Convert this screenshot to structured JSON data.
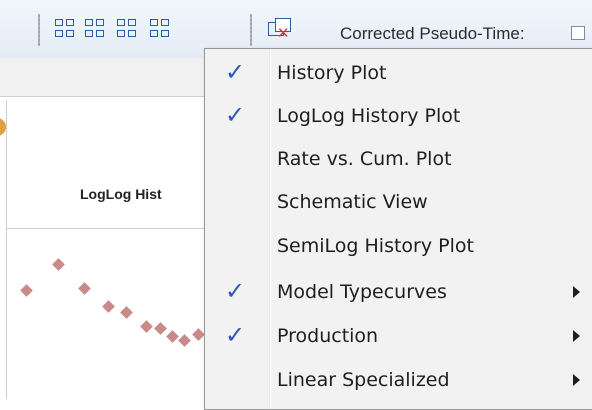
{
  "toolbar": {
    "corrected_label": "Corrected Pseudo-Time:",
    "corrected_checked": false
  },
  "plot": {
    "title": "LogLog Hist"
  },
  "menu": {
    "items": [
      {
        "label": "History Plot",
        "checked": true,
        "submenu": false
      },
      {
        "label": "LogLog History Plot",
        "checked": true,
        "submenu": false
      },
      {
        "label": "Rate vs. Cum. Plot",
        "checked": false,
        "submenu": false
      },
      {
        "label": "Schematic View",
        "checked": false,
        "submenu": false
      },
      {
        "label": "SemiLog History Plot",
        "checked": false,
        "submenu": false
      },
      {
        "label": "Model Typecurves",
        "checked": true,
        "submenu": true
      },
      {
        "label": "Production",
        "checked": true,
        "submenu": true
      },
      {
        "label": "Linear Specialized",
        "checked": false,
        "submenu": true
      }
    ],
    "check_glyph": "✓"
  },
  "colors": {
    "accent": "#2d58b8",
    "points": "#c98a8a"
  }
}
